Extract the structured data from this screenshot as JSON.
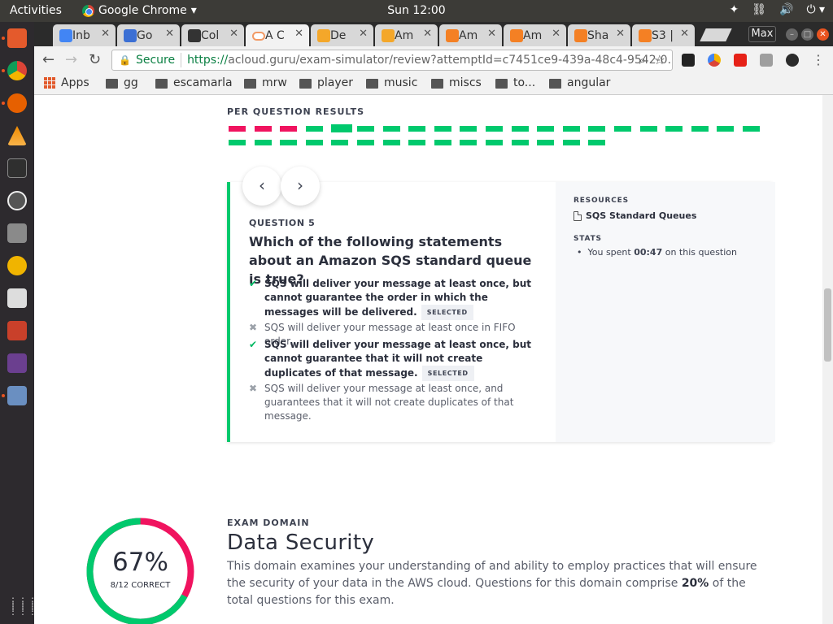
{
  "topbar": {
    "activities": "Activities",
    "app_name": "Google Chrome",
    "app_caret": "▾",
    "clock": "Sun 12:00",
    "tray_icons": [
      "ubuntu-one-icon",
      "network-icon",
      "volume-icon",
      "power-icon"
    ]
  },
  "dock": {
    "apps": [
      "files-icon",
      "chrome-icon",
      "firefox-icon",
      "vlc-icon",
      "terminal-icon",
      "updater-icon",
      "installer-icon",
      "headphones-icon",
      "video-editor-icon",
      "settings-tools-icon",
      "font-viewer-icon",
      "image-viewer-icon"
    ],
    "show_apps": "⋮⋮⋮"
  },
  "tabs": [
    {
      "label": "Inb",
      "favicon": "mail-icon",
      "color": "#4285f4"
    },
    {
      "label": "Go",
      "favicon": "calendar-icon",
      "color": "#3b6fd4"
    },
    {
      "label": "Col",
      "favicon": "film-icon",
      "color": "#333333"
    },
    {
      "label": "A C",
      "favicon": "cloud-icon",
      "color": "#f29a65",
      "active": true
    },
    {
      "label": "De",
      "favicon": "aws-icon",
      "color": "#f4a72a"
    },
    {
      "label": "Am",
      "favicon": "aws-icon",
      "color": "#f4a72a"
    },
    {
      "label": "Am",
      "favicon": "aws-cube-icon",
      "color": "#f48024"
    },
    {
      "label": "Am",
      "favicon": "aws-cube-icon",
      "color": "#f48024"
    },
    {
      "label": "Sha",
      "favicon": "aws-cube-icon",
      "color": "#f48024"
    },
    {
      "label": "S3 |",
      "favicon": "aws-cube-icon",
      "color": "#f48024"
    }
  ],
  "window": {
    "max_label": "Max"
  },
  "omnibox": {
    "secure_label": "Secure",
    "url_scheme": "https://",
    "url_rest": "acloud.guru/exam-simulator/review?attemptId=c7451ce9-439a-48c4-9542-0..."
  },
  "extensions": [
    {
      "name": "k-extension-icon",
      "color": "#222222"
    },
    {
      "name": "color-wheel-icon",
      "color": "#f4b400"
    },
    {
      "name": "youtube-icon",
      "color": "#e62117"
    },
    {
      "name": "shield-extension-icon",
      "color": "#9e9e9e"
    },
    {
      "name": "react-devtools-icon",
      "color": "#2b2b2b"
    }
  ],
  "bookmarks": {
    "apps_label": "Apps",
    "folders": [
      "gg",
      "escamarla",
      "mrw",
      "player",
      "music",
      "miscs",
      "to...",
      "angular"
    ]
  },
  "results": {
    "label": "PER QUESTION RESULTS",
    "row1": [
      "bad",
      "bad",
      "bad",
      "good",
      "good",
      "good",
      "good",
      "good",
      "good",
      "good",
      "good",
      "good",
      "good",
      "good",
      "good",
      "good",
      "good",
      "good",
      "good",
      "good",
      "good"
    ],
    "row2": [
      "good",
      "good",
      "good",
      "good",
      "good",
      "good",
      "good",
      "good",
      "good",
      "good",
      "good",
      "good",
      "good",
      "good",
      "good"
    ]
  },
  "question": {
    "prev": "‹",
    "next": "›",
    "number": "QUESTION 5",
    "text": "Which of the following statements about an Amazon SQS standard queue is true?",
    "answers": [
      {
        "text": "SQS will deliver your message at least once, but cannot guarantee the order in which the messages will be delivered.",
        "correct": true,
        "selected": true
      },
      {
        "text": "SQS will deliver your message at least once in FIFO order.",
        "correct": false,
        "selected": false
      },
      {
        "text": "SQS will deliver your message at least once, but cannot guarantee that it will not create duplicates of that message.",
        "correct": true,
        "selected": true
      },
      {
        "text": "SQS will deliver your message at least once, and guarantees that it will not create duplicates of that message.",
        "correct": false,
        "selected": false
      }
    ],
    "selected_badge": "SELECTED",
    "resources_label": "RESOURCES",
    "resource_link": "SQS Standard Queues",
    "stats_label": "STATS",
    "stat_prefix": "You spent ",
    "stat_time": "00:47",
    "stat_suffix": " on this question"
  },
  "domain": {
    "label": "EXAM DOMAIN",
    "title": "Data Security",
    "percent": "67%",
    "percent_value": 0.67,
    "score": "8/12 CORRECT",
    "desc_pre": "This domain examines your understanding of and ability to employ practices that will ensure the security of your data in the AWS cloud. Questions for this domain comprise ",
    "desc_bold": "20%",
    "desc_post": " of the total questions for this exam.",
    "ring_colors": {
      "good": "#00c96d",
      "bad": "#f0135f"
    }
  }
}
